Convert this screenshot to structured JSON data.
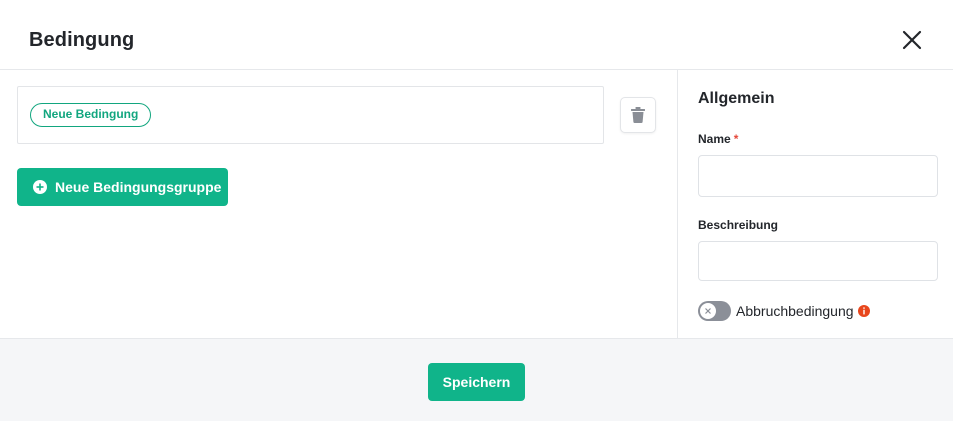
{
  "dialog": {
    "title": "Bedingung",
    "close_icon": "close-icon"
  },
  "conditions": {
    "chip_label": "Neue Bedingung",
    "delete_icon": "trash-icon",
    "add_group_label": "Neue Bedingungsgruppe",
    "add_group_icon": "plus-circle-icon"
  },
  "general": {
    "title": "Allgemein",
    "name_label": "Name",
    "name_required_marker": "*",
    "name_value": "",
    "description_label": "Beschreibung",
    "description_value": "",
    "abort_toggle_label": "Abbruchbedingung",
    "abort_toggle_on": false,
    "info_icon": "info-icon"
  },
  "footer": {
    "save_label": "Speichern"
  },
  "colors": {
    "accent": "#10b48a",
    "chip_border": "#12a67f",
    "required": "#e5483a",
    "info": "#e8461c",
    "footer_bg": "#f5f6f8"
  }
}
